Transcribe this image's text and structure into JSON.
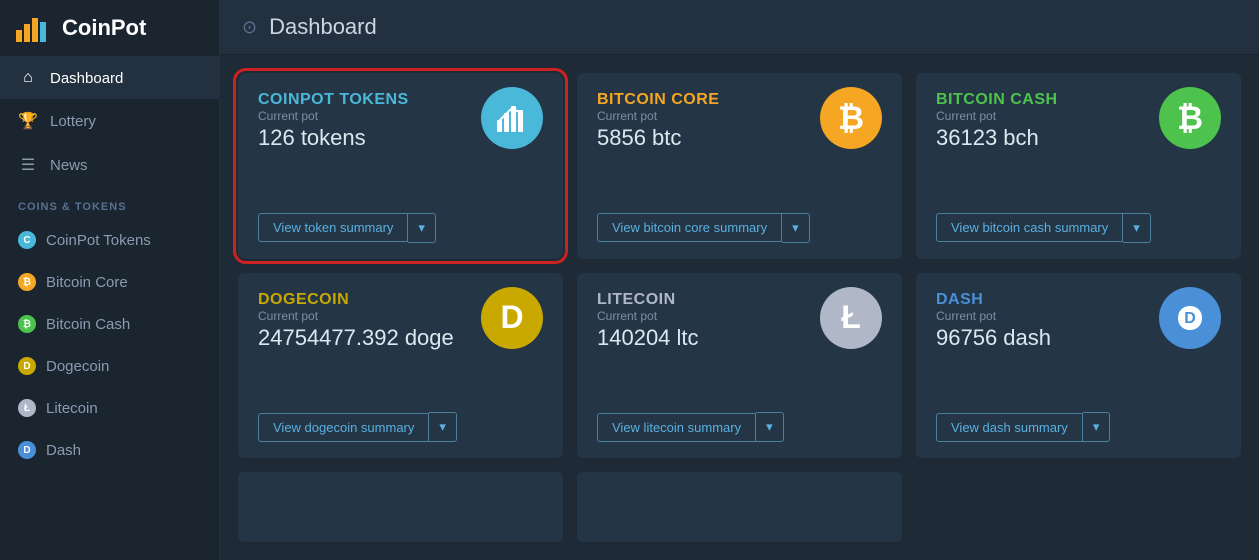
{
  "logo": {
    "text": "CoinPot"
  },
  "sidebar": {
    "nav": [
      {
        "id": "dashboard",
        "label": "Dashboard",
        "icon": "⌂",
        "active": true
      },
      {
        "id": "lottery",
        "label": "Lottery",
        "icon": "🏆"
      },
      {
        "id": "news",
        "label": "News",
        "icon": "☰"
      }
    ],
    "section_label": "COINS & TOKENS",
    "coins": [
      {
        "id": "coinpot-tokens",
        "label": "CoinPot Tokens",
        "color": "#4ab8d8",
        "symbol": "C"
      },
      {
        "id": "bitcoin-core",
        "label": "Bitcoin Core",
        "color": "#f5a623",
        "symbol": "₿"
      },
      {
        "id": "bitcoin-cash",
        "label": "Bitcoin Cash",
        "color": "#4dc34d",
        "symbol": "₿"
      },
      {
        "id": "dogecoin",
        "label": "Dogecoin",
        "color": "#c9a800",
        "symbol": "D"
      },
      {
        "id": "litecoin",
        "label": "Litecoin",
        "color": "#b0b8c8",
        "symbol": "Ł"
      },
      {
        "id": "dash",
        "label": "Dash",
        "color": "#4a90d9",
        "symbol": "D"
      }
    ]
  },
  "topbar": {
    "title": "Dashboard",
    "icon": "⊙"
  },
  "cards": [
    {
      "id": "coinpot-tokens",
      "name": "COINPOT TOKENS",
      "color_class": "color-token",
      "circle_color": "#4ab8d8",
      "circle_symbol": "📊",
      "circle_unicode": "📊",
      "label": "Current pot",
      "amount": "126 tokens",
      "button_label": "View token summary",
      "highlighted": true
    },
    {
      "id": "bitcoin-core",
      "name": "BITCOIN CORE",
      "color_class": "color-btc",
      "circle_color": "#f5a623",
      "circle_symbol": "₿",
      "label": "Current pot",
      "amount": "5856 btc",
      "button_label": "View bitcoin core summary",
      "highlighted": false
    },
    {
      "id": "bitcoin-cash",
      "name": "BITCOIN CASH",
      "color_class": "color-bch",
      "circle_color": "#4dc34d",
      "circle_symbol": "₿",
      "label": "Current pot",
      "amount": "36123 bch",
      "button_label": "View bitcoin cash summary",
      "highlighted": false
    },
    {
      "id": "dogecoin",
      "name": "DOGECOIN",
      "color_class": "color-doge",
      "circle_color": "#c9a800",
      "circle_symbol": "D",
      "label": "Current pot",
      "amount": "24754477.392 doge",
      "button_label": "View dogecoin summary",
      "highlighted": false
    },
    {
      "id": "litecoin",
      "name": "LITECOIN",
      "color_class": "color-ltc",
      "circle_color": "#b0b8c8",
      "circle_symbol": "Ł",
      "label": "Current pot",
      "amount": "140204 ltc",
      "button_label": "View litecoin summary",
      "highlighted": false
    },
    {
      "id": "dash",
      "name": "DASH",
      "color_class": "color-dash",
      "circle_color": "#4a90d9",
      "circle_symbol": "D",
      "label": "Current pot",
      "amount": "96756 dash",
      "button_label": "View dash summary",
      "highlighted": false
    }
  ],
  "partial_cards": [
    {
      "id": "partial-1"
    },
    {
      "id": "partial-2"
    }
  ]
}
